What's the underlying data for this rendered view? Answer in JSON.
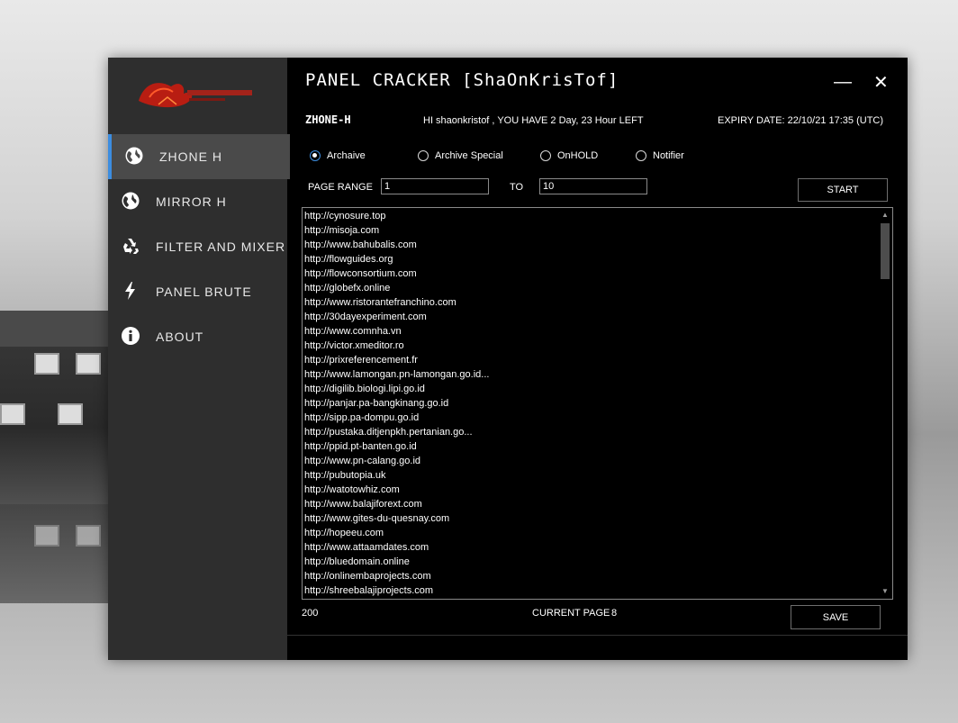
{
  "app": {
    "title": "PANEL CRACKER [ShaOnKrisTof]",
    "minimize": "—",
    "close": "✕"
  },
  "sidebar": {
    "items": [
      {
        "label": "ZHONE H",
        "icon": "globe-icon",
        "active": true
      },
      {
        "label": "MIRROR H",
        "icon": "globe-icon",
        "active": false
      },
      {
        "label": "FILTER AND MIXER",
        "icon": "recycle-icon",
        "active": false
      },
      {
        "label": "PANEL BRUTE",
        "icon": "lightning-icon",
        "active": false
      },
      {
        "label": "ABOUT",
        "icon": "info-icon",
        "active": false
      }
    ]
  },
  "header": {
    "section": "ZHONE-H",
    "greeting": "HI shaonkristof , YOU HAVE 2 Day, 23 Hour LEFT",
    "expiry": "EXPIRY DATE: 22/10/21 17:35 (UTC)"
  },
  "options": [
    {
      "label": "Archaive",
      "checked": true
    },
    {
      "label": "Archive Special",
      "checked": false
    },
    {
      "label": "OnHOLD",
      "checked": false
    },
    {
      "label": "Notifier",
      "checked": false
    }
  ],
  "range": {
    "label": "PAGE RANGE",
    "from": "1",
    "to_label": "TO",
    "to": "10",
    "start": "START"
  },
  "urls": [
    "http://cynosure.top",
    "http://misoja.com",
    "http://www.bahubalis.com",
    "http://flowguides.org",
    "http://flowconsortium.com",
    "http://globefx.online",
    "http://www.ristorantefranchino.com",
    "http://30dayexperiment.com",
    "http://www.comnha.vn",
    "http://victor.xmeditor.ro",
    "http://prixreferencement.fr",
    "http://www.lamongan.pn-lamongan.go.id...",
    "http://digilib.biologi.lipi.go.id",
    "http://panjar.pa-bangkinang.go.id",
    "http://sipp.pa-dompu.go.id",
    "http://pustaka.ditjenpkh.pertanian.go...",
    "http://ppid.pt-banten.go.id",
    "http://www.pn-calang.go.id",
    "http://pubutopia.uk",
    "http://watotowhiz.com",
    "http://www.balajiforext.com",
    "http://www.gites-du-quesnay.com",
    "http://hopeeu.com",
    "http://www.attaamdates.com",
    "http://bluedomain.online",
    "http://onlinembaprojects.com",
    "http://shreebalajiprojects.com"
  ],
  "footer": {
    "count": "200",
    "current_page_label": "CURRENT PAGE",
    "current_page": "8",
    "save": "SAVE"
  },
  "colors": {
    "accent": "#3c8de0",
    "sidebar": "#2e2e2e",
    "sidebar_active": "#4a4a4a",
    "window": "#000000"
  }
}
